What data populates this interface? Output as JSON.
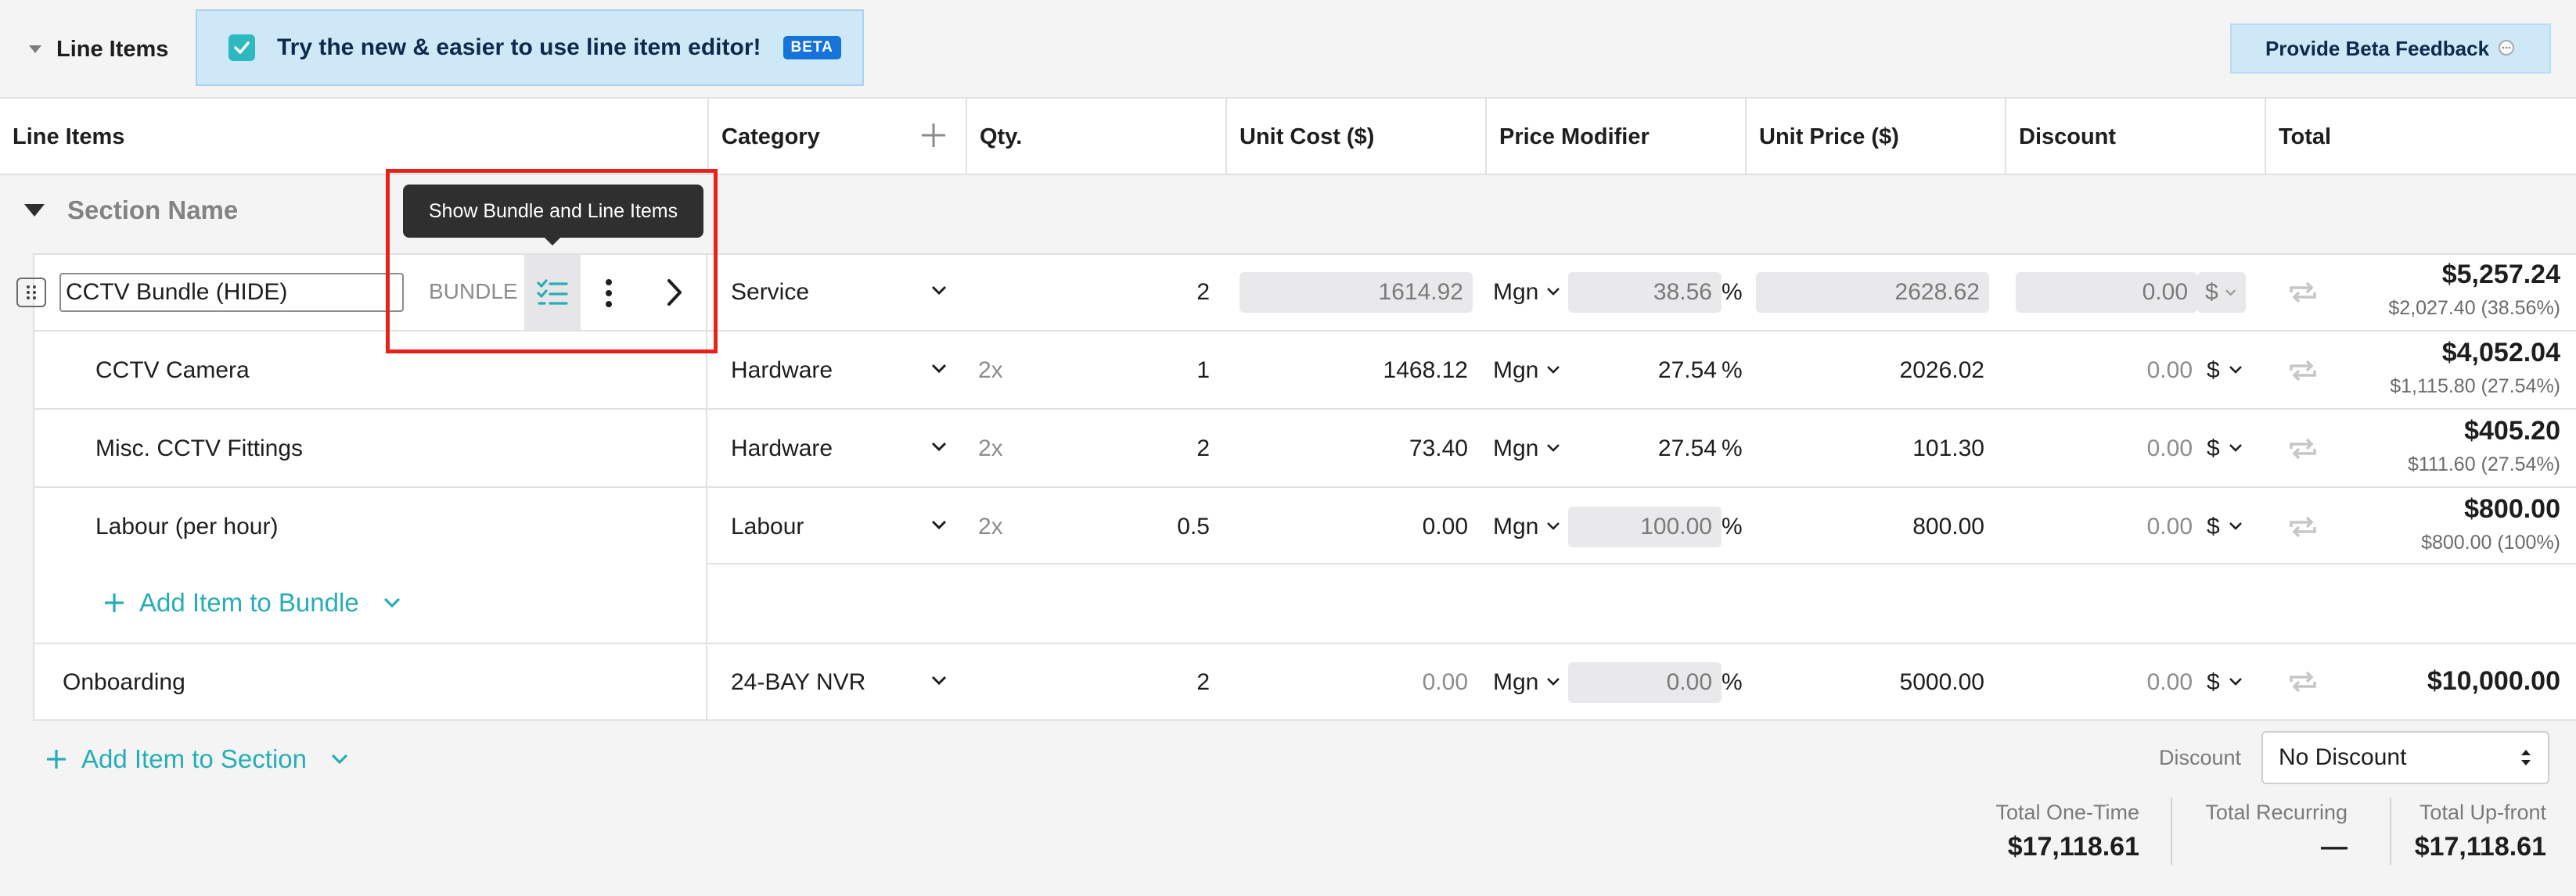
{
  "header": {
    "section_title": "Line Items",
    "banner_text": "Try the new & easier to use line item editor!",
    "beta_badge": "BETA",
    "feedback_label": "Provide Beta Feedback"
  },
  "columns": [
    "Line Items",
    "Category",
    "Qty.",
    "Unit Cost ($)",
    "Price Modifier",
    "Unit Price ($)",
    "Discount",
    "Total"
  ],
  "section": {
    "name": "Section Name"
  },
  "bundle": {
    "name": "CCTV Bundle (HIDE)",
    "tag": "BUNDLE",
    "tooltip": "Show Bundle and Line Items",
    "category": "Service",
    "qty": "2",
    "unit_cost": "1614.92",
    "modifier": "Mgn",
    "modifier_value": "38.56",
    "unit_price": "2628.62",
    "discount": "0.00",
    "discount_type": "$",
    "total": "$5,257.24",
    "total_sub": "$2,027.40 (38.56%)"
  },
  "items": [
    {
      "name": "CCTV Camera",
      "category": "Hardware",
      "mult": "2x",
      "qty": "1",
      "unit_cost": "1468.12",
      "modifier": "Mgn",
      "modifier_value": "27.54",
      "pct": "%",
      "unit_price": "2026.02",
      "discount": "0.00",
      "discount_type": "$",
      "total": "$4,052.04",
      "total_sub": "$1,115.80 (27.54%)"
    },
    {
      "name": "Misc. CCTV Fittings",
      "category": "Hardware",
      "mult": "2x",
      "qty": "2",
      "unit_cost": "73.40",
      "modifier": "Mgn",
      "modifier_value": "27.54",
      "pct": "%",
      "unit_price": "101.30",
      "discount": "0.00",
      "discount_type": "$",
      "total": "$405.20",
      "total_sub": "$111.60 (27.54%)"
    },
    {
      "name": "Labour (per hour)",
      "category": "Labour",
      "mult": "2x",
      "qty": "0.5",
      "unit_cost": "0.00",
      "modifier": "Mgn",
      "modifier_value": "100.00",
      "pct": "%",
      "unit_price": "800.00",
      "discount": "0.00",
      "discount_type": "$",
      "total": "$800.00",
      "total_sub": "$800.00 (100%)"
    }
  ],
  "add_to_bundle": "Add Item to Bundle",
  "onboarding": {
    "name": "Onboarding",
    "category": "24-BAY NVR",
    "qty": "2",
    "unit_cost": "0.00",
    "modifier": "Mgn",
    "modifier_value": "0.00",
    "pct": "%",
    "unit_price": "5000.00",
    "discount": "0.00",
    "discount_type": "$",
    "total": "$10,000.00"
  },
  "add_to_section": "Add Item to Section",
  "summary": {
    "discount_label": "Discount",
    "discount_value": "No Discount",
    "one_time_label": "Total One-Time",
    "one_time_value": "$17,118.61",
    "recurring_label": "Total Recurring",
    "recurring_value": "—",
    "upfront_label": "Total Up-front",
    "upfront_value": "$17,118.61"
  },
  "colors": {
    "accent": "#27adb5",
    "banner": "#cfe8f8",
    "badge": "#1673d9",
    "highlight": "#e8211b"
  }
}
